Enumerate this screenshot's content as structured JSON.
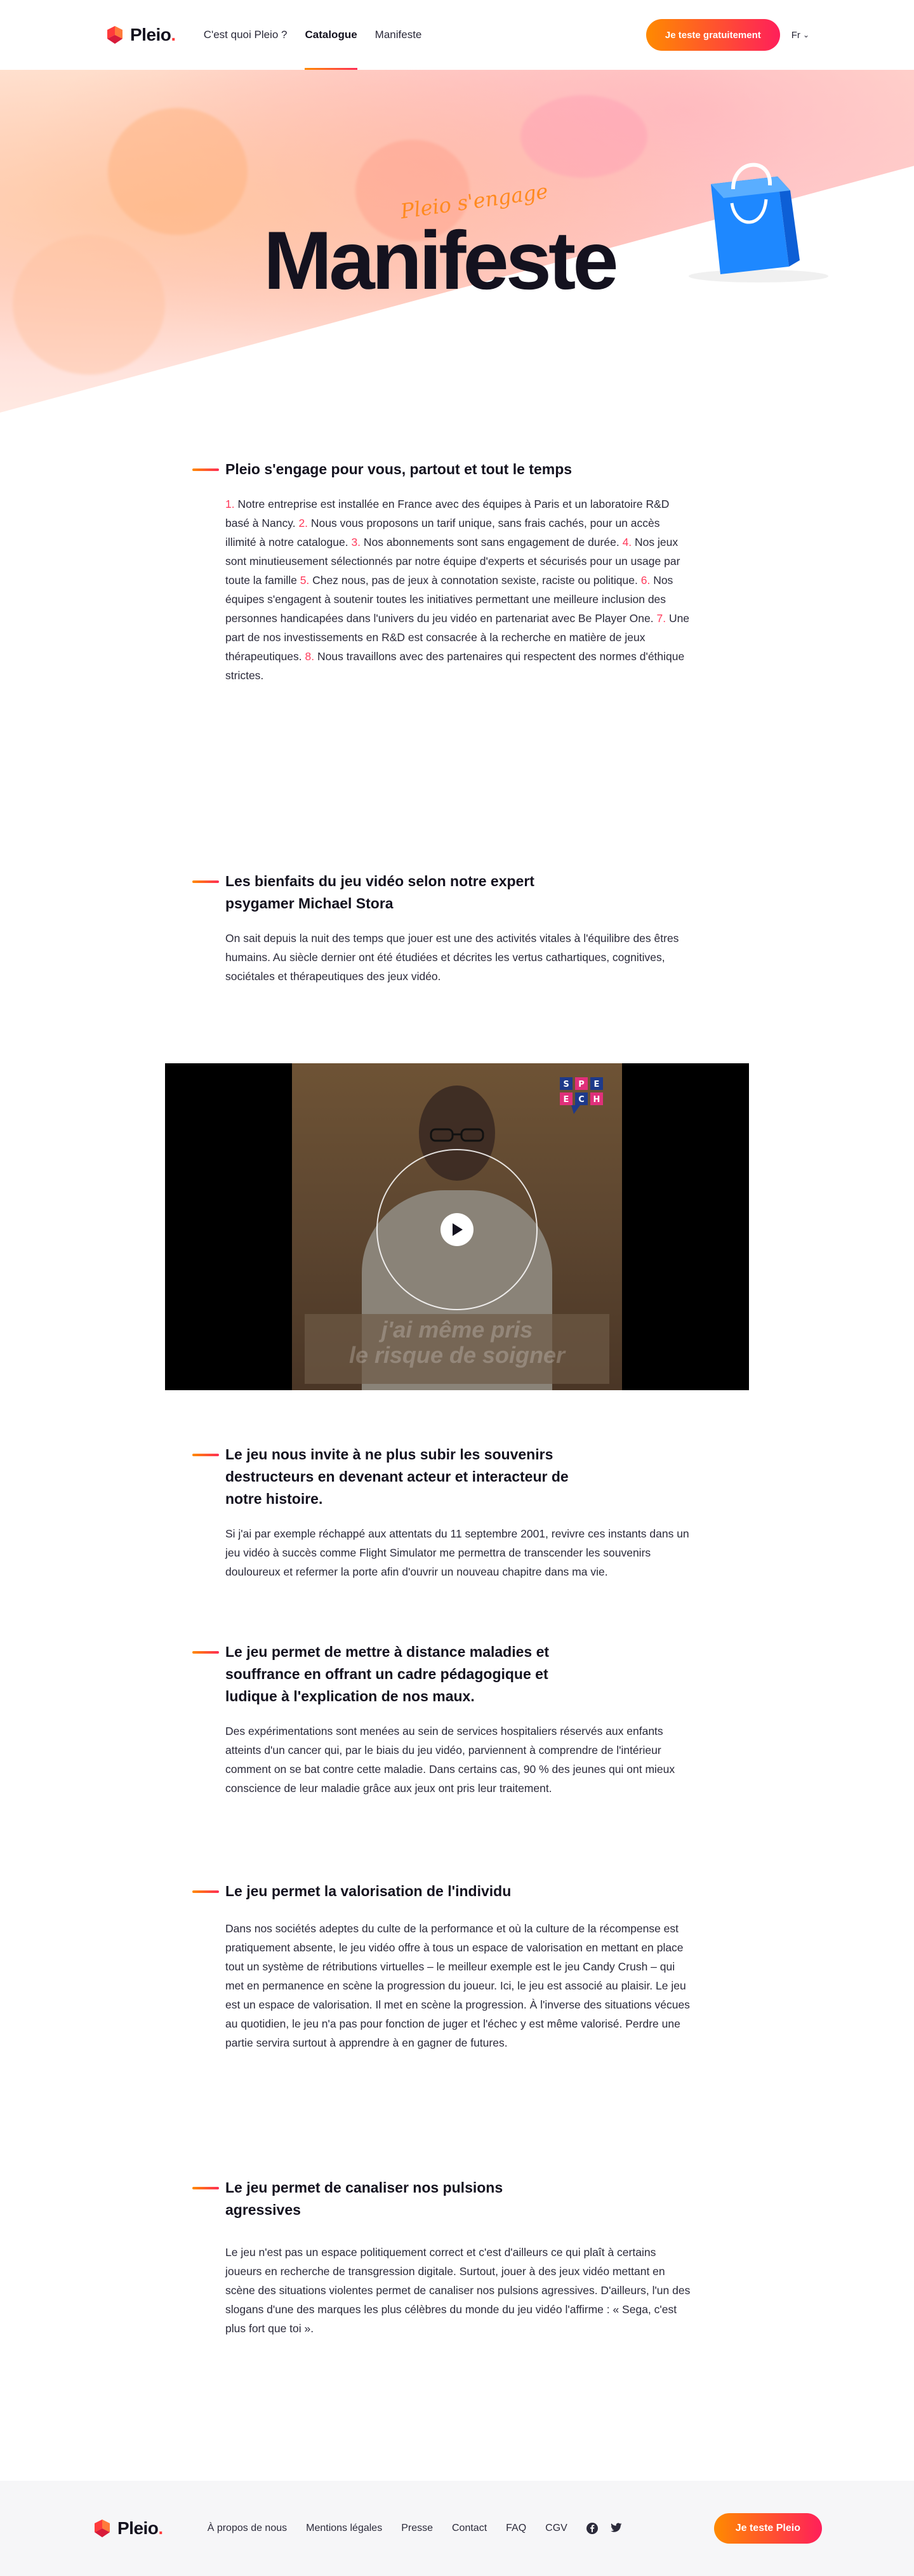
{
  "header": {
    "logo_text": "Pleio",
    "logo_dot": ".",
    "nav": [
      {
        "label": "C'est quoi Pleio ?"
      },
      {
        "label": "Catalogue"
      },
      {
        "label": "Manifeste"
      }
    ],
    "cta_label": "Je teste gratuitement",
    "lang_label": "Fr",
    "lang_caret": "⌄"
  },
  "hero": {
    "tag": "Pleio s'engage",
    "title": "Manifeste"
  },
  "sections": [
    {
      "title": "Pleio s'engage pour vous, partout et tout le temps",
      "items": [
        {
          "num": "1.",
          "text": " Notre entreprise est installée en France avec des équipes à Paris et un laboratoire R&D basé à Nancy.    "
        },
        {
          "num": "2.",
          "text": " Nous vous proposons un tarif unique, sans frais cachés, pour un accès illimité à notre catalogue.    "
        },
        {
          "num": "3.",
          "text": " Nos abonnements sont sans engagement de durée.    "
        },
        {
          "num": "4.",
          "text": " Nos jeux sont minutieusement sélectionnés par notre équipe d'experts et sécurisés pour un usage par toute la famille    "
        },
        {
          "num": "5.",
          "text": " Chez nous, pas de jeux à connotation sexiste, raciste ou politique.    "
        },
        {
          "num": "6.",
          "text": " Nos équipes s'engagent à soutenir toutes les initiatives permettant une meilleure inclusion des personnes handicapées dans l'univers du jeu vidéo en partenariat avec Be Player One.    "
        },
        {
          "num": "7.",
          "text": " Une part de nos investissements en R&D est consacrée à la recherche en matière de jeux thérapeutiques.    "
        },
        {
          "num": "8.",
          "text": " Nous travaillons avec des partenaires qui respectent des normes d'éthique strictes."
        }
      ]
    },
    {
      "title": "Les bienfaits du jeu vidéo selon notre expert psygamer Michael Stora",
      "body": "On sait depuis la nuit des temps que jouer est une des activités vitales à l'équilibre des êtres humains.    Au siècle dernier ont été étudiées et décrites les vertus cathartiques, cognitives, sociétales et thérapeutiques des jeux vidéo."
    },
    {
      "title": "Le jeu nous invite à ne plus subir les souvenirs destructeurs en devenant acteur et interacteur de notre histoire.",
      "body": "Si j'ai par exemple réchappé aux attentats du 11 septembre 2001, revivre ces instants dans un jeu vidéo à succès comme Flight Simulator me permettra de transcender les souvenirs douloureux et refermer la porte afin d'ouvrir un nouveau chapitre dans ma vie."
    },
    {
      "title": "Le jeu permet de mettre à distance maladies et souffrance en offrant un cadre pédagogique et ludique à l'explication de nos maux.",
      "body": "Des expérimentations sont menées au sein de services hospitaliers réservés aux enfants atteints d'un cancer qui, par le biais du jeu vidéo, parviennent à comprendre de l'intérieur comment on se bat contre cette maladie.    Dans certains cas, 90 % des jeunes qui ont mieux conscience de leur maladie grâce aux jeux ont pris leur traitement."
    },
    {
      "title": "Le jeu permet la valorisation de l'individu",
      "body": "Dans nos sociétés adeptes du culte de la performance et où la culture de la récompense est pratiquement absente, le jeu vidéo offre à tous un espace de valorisation en mettant en place tout un système de rétributions virtuelles – le meilleur exemple est le jeu Candy Crush – qui met en permanence en scène la progression du joueur.    Ici, le jeu est associé au plaisir. Le jeu est un espace de valorisation. Il met en scène la progression.    À l'inverse des situations vécues au quotidien, le jeu n'a pas pour fonction de juger et l'échec y est même valorisé. Perdre une partie servira surtout à apprendre à en gagner de futures."
    },
    {
      "title": "Le jeu permet de canaliser nos pulsions agressives",
      "body": "Le jeu n'est pas un espace politiquement correct et c'est d'ailleurs ce qui plaît à certains joueurs en recherche de transgression digitale. Surtout, jouer à des jeux vidéo mettant en scène des situations violentes permet de canaliser nos pulsions agressives. D'ailleurs, l'un des slogans d'une des marques les plus célèbres du monde du jeu vidéo l'affirme : « Sega, c'est plus fort que toi »."
    }
  ],
  "video": {
    "subtitle_line1": "j'ai même pris",
    "subtitle_line2": "le risque de soigner",
    "logo_letters": [
      "S",
      "P",
      "E",
      "E",
      "C",
      "H"
    ]
  },
  "footer": {
    "logo_text": "Pleio",
    "logo_dot": ".",
    "links": [
      {
        "label": "À propos de nous"
      },
      {
        "label": "Mentions légales"
      },
      {
        "label": "Presse"
      },
      {
        "label": "Contact"
      },
      {
        "label": "FAQ"
      },
      {
        "label": "CGV"
      }
    ],
    "cta_label": "Je teste Pleio"
  },
  "colors": {
    "accent_start": "#ff8a00",
    "accent_end": "#ff1f5a",
    "number_color": "#ff3b5c",
    "bag_blue": "#1e88ff"
  }
}
